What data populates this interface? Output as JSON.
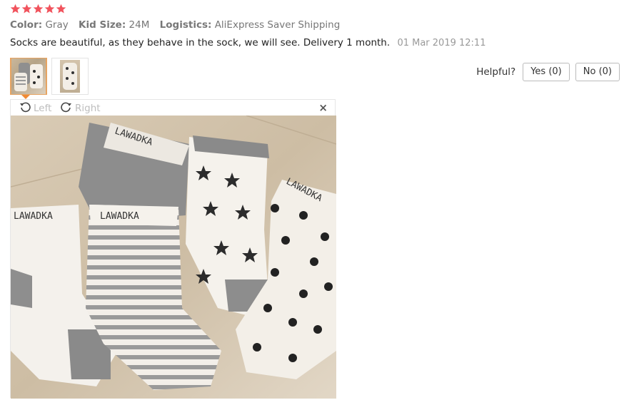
{
  "rating": {
    "stars": 5,
    "star_color": "#f1535d"
  },
  "attributes": [
    {
      "key": "Color:",
      "value": "Gray"
    },
    {
      "key": "Kid Size:",
      "value": "24M"
    },
    {
      "key": "Logistics:",
      "value": "AliExpress Saver Shipping"
    }
  ],
  "review": {
    "text": "Socks are beautiful, as they behave in the sock, we will see. Delivery 1 month.",
    "date": "01 Mar 2019 12:11"
  },
  "helpful": {
    "label": "Helpful?",
    "yes_label": "Yes (0)",
    "no_label": "No (0)"
  },
  "viewer": {
    "rotate_left_label": "Left",
    "rotate_right_label": "Right",
    "close_glyph": "×",
    "rotate_left_icon": "rotate-left-icon",
    "rotate_right_icon": "rotate-right-icon"
  },
  "photo": {
    "sock_brand_text": "LAWADKA"
  },
  "colors": {
    "accent_orange": "#f08a34",
    "active_thumb_border": "#e7a462"
  }
}
